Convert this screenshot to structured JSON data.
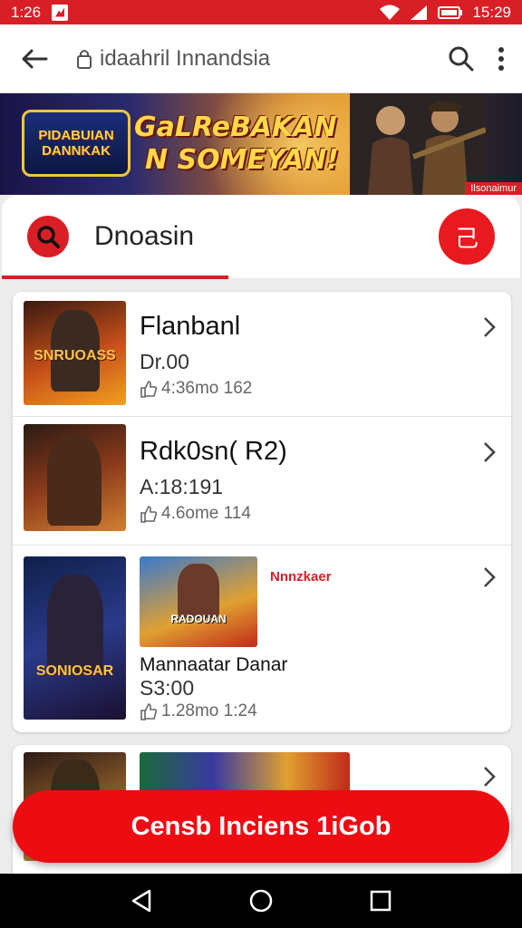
{
  "status_bar": {
    "time": "1:26",
    "battery_time": "15:29"
  },
  "app_bar": {
    "url": "idaahril Innandsia",
    "back_icon": "arrow-left-icon",
    "search_icon": "search-icon",
    "menu_icon": "more-vert-icon"
  },
  "banner": {
    "logo_line1": "PIDABUIAN",
    "logo_line2": "DANNKAK",
    "title_line1": "GaLReBAKAN",
    "title_line2": "N SOMEYAN!",
    "tag": "Ilsonaimur"
  },
  "search": {
    "query": "Dnoasin",
    "filter_label": "己"
  },
  "results": [
    {
      "title": "Flanbanl",
      "price": "Dr.00",
      "meta": "4:36mo 162",
      "thumb_text": "SNRUOASS"
    },
    {
      "title": "Rdk0sn( R2)",
      "price": "A:18:191",
      "meta": "4.6ome 114",
      "thumb_text": ""
    },
    {
      "title": "Mannaatar Danar",
      "price": "S3:00",
      "meta": "1.28mo 1:24",
      "thumb_text": "SONIOSAR",
      "inner_thumb_text": "RADOUAN",
      "promo": "Nnnzkaer"
    }
  ],
  "cta": {
    "label": "Censb Inciens 1iGob"
  },
  "colors": {
    "brand_red": "#d81f26",
    "cta_red": "#ec0c12"
  }
}
